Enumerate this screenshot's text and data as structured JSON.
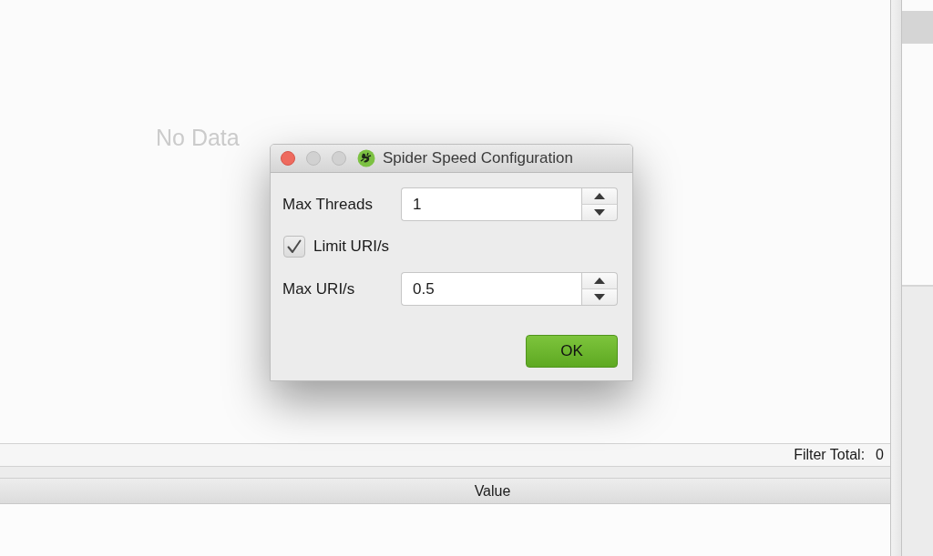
{
  "results_panel": {
    "empty_message": "No Data",
    "filter_total": {
      "label": "Filter Total:",
      "value": "0"
    }
  },
  "details_table": {
    "columns": [
      "Value"
    ]
  },
  "dialog": {
    "title": "Spider Speed Configuration",
    "fields": [
      {
        "kind": "spinner",
        "label": "Max Threads",
        "value": "1"
      },
      {
        "kind": "checkbox",
        "label": "Limit URI/s",
        "checked": true
      },
      {
        "kind": "spinner",
        "label": "Max URI/s",
        "value": "0.5"
      }
    ],
    "buttons": [
      "OK"
    ]
  }
}
